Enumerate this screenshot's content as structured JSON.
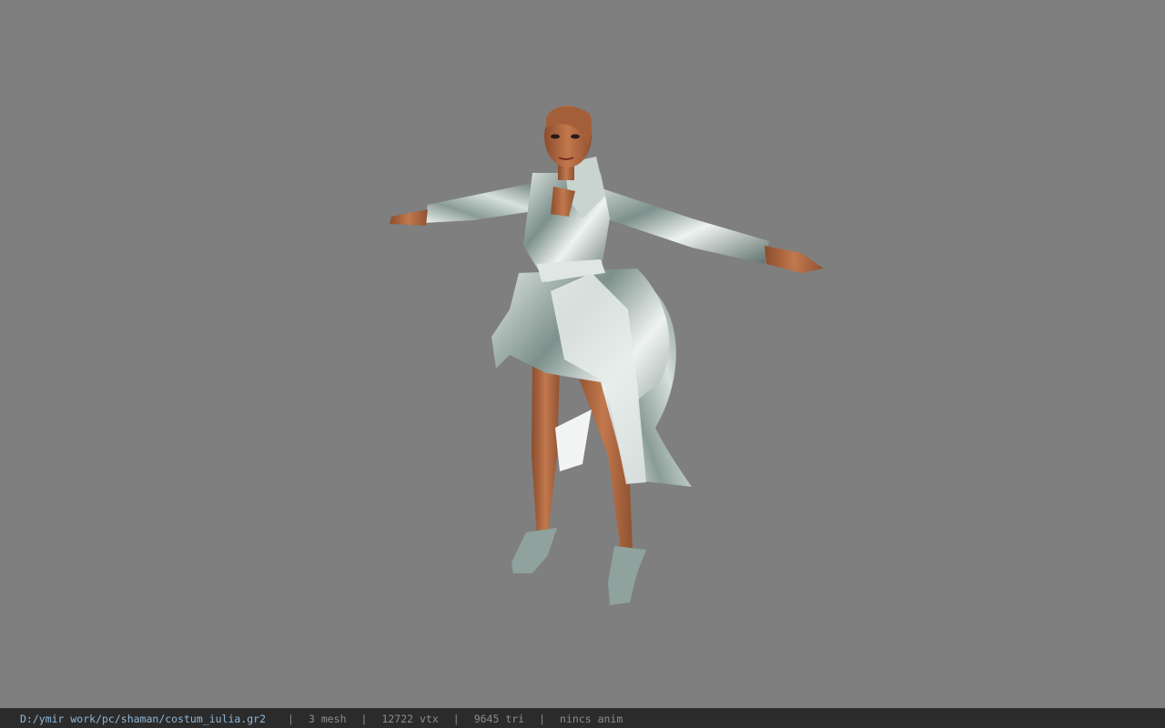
{
  "viewport": {
    "background": "#7f7f7f",
    "model_name": "character-model"
  },
  "status_bar": {
    "file_path": "D:/ymir work/pc/shaman/costum_iulia.gr2",
    "separator": "|",
    "mesh_count": "3 mesh",
    "vertex_count": "12722 vtx",
    "triangle_count": "9645 tri",
    "anim_status": "nincs anim"
  }
}
